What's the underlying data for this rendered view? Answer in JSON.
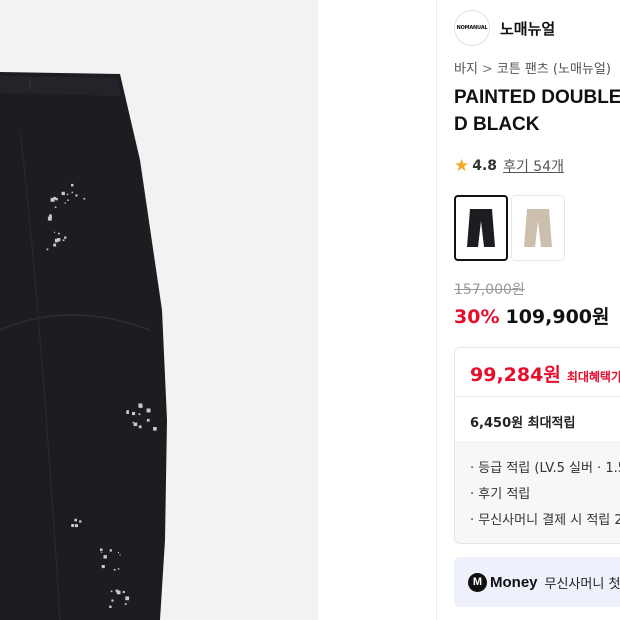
{
  "brand": {
    "logo_text": "NOMANUAL",
    "name": "노매뉴얼"
  },
  "breadcrumb": {
    "category": "바지",
    "separator": ">",
    "subcategory": "코튼 팬츠 (노매뉴얼)"
  },
  "product": {
    "title_line1": "PAINTED DOUBLE",
    "title_line2": "D BLACK",
    "rating": "4.8",
    "reviews_label": "후기 54개",
    "original_price": "157,000원",
    "discount": "30%",
    "sale_price": "109,900원",
    "swatches": [
      {
        "name": "black",
        "color": "#1c1d21"
      },
      {
        "name": "beige",
        "color": "#cdbfae"
      }
    ]
  },
  "benefits": {
    "max_price": "99,284원",
    "max_label": "최대혜택가",
    "points": "6,450원 최대적립",
    "items": [
      "· 등급 적립 (LV.5 실버 · 1.5",
      "· 후기 적립",
      "· 무신사머니 결제 시 적립 2"
    ]
  },
  "money": {
    "icon": "M",
    "label": "Money",
    "text": "무신사머니 첫"
  },
  "colors": {
    "accent_red": "#e60e2d",
    "star": "#f5a623",
    "pants": "#1c1d21"
  }
}
